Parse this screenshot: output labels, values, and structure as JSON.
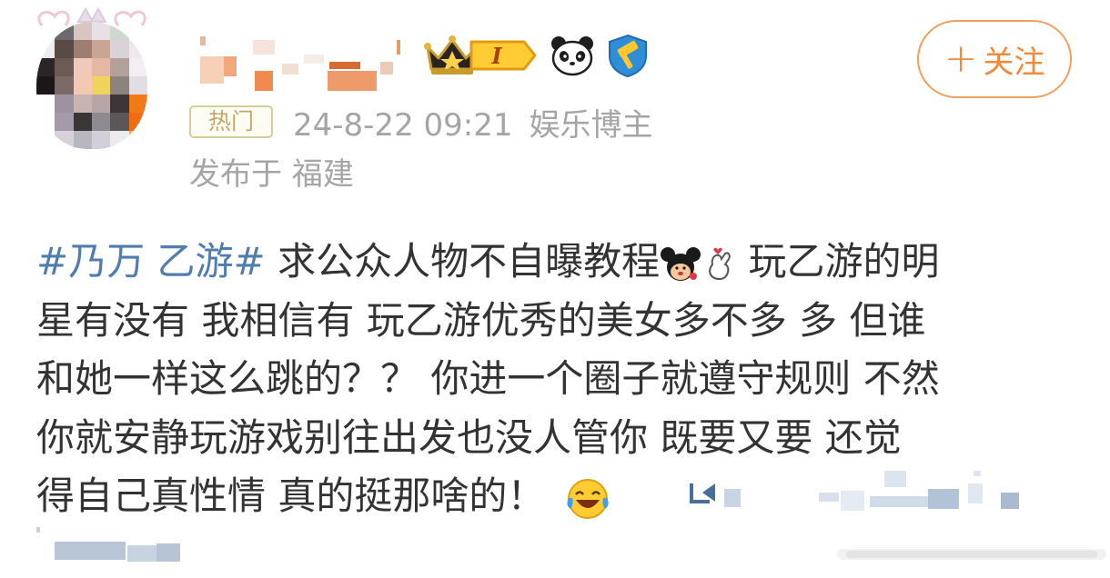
{
  "header": {
    "follow_label": "关注",
    "follow_plus": "+"
  },
  "meta": {
    "hot_tag": "热门",
    "timestamp": "24-8-22 09:21",
    "role": "娱乐博主",
    "location": "发布于 福建"
  },
  "post": {
    "hashtag": "#乃万 乙游#",
    "line1_text": " 求公众人物不自曝教程",
    "line1_tail": " 玩乙游的明",
    "line2": "星有没有 我相信有 玩乙游优秀的美女多不多 多 但谁",
    "line3": "和她一样这么跳的？？ 你进一个圈子就遵守规则 不然",
    "line4": "你就安静玩游戏别往出发也没人管你 既要又要 还觉",
    "line5": "得自己真性情 真的挺那啥的！"
  },
  "badges": {
    "level_letter": "I"
  },
  "icons": {
    "avatar": "avatar-image",
    "crown": "crown-icon",
    "level": "level-badge-icon",
    "panda": "panda-icon",
    "hammer": "hammer-verified-icon",
    "mickey": "mickey-emoji-icon",
    "finger_heart": "finger-heart-emoji-icon",
    "laugh_cry": "laugh-cry-emoji-icon"
  },
  "colors": {
    "follow_orange": "#f08a3a",
    "hashtag_blue": "#507daf",
    "meta_gray": "#a5a5a5",
    "hot_tag_gold": "#c2a76a"
  }
}
